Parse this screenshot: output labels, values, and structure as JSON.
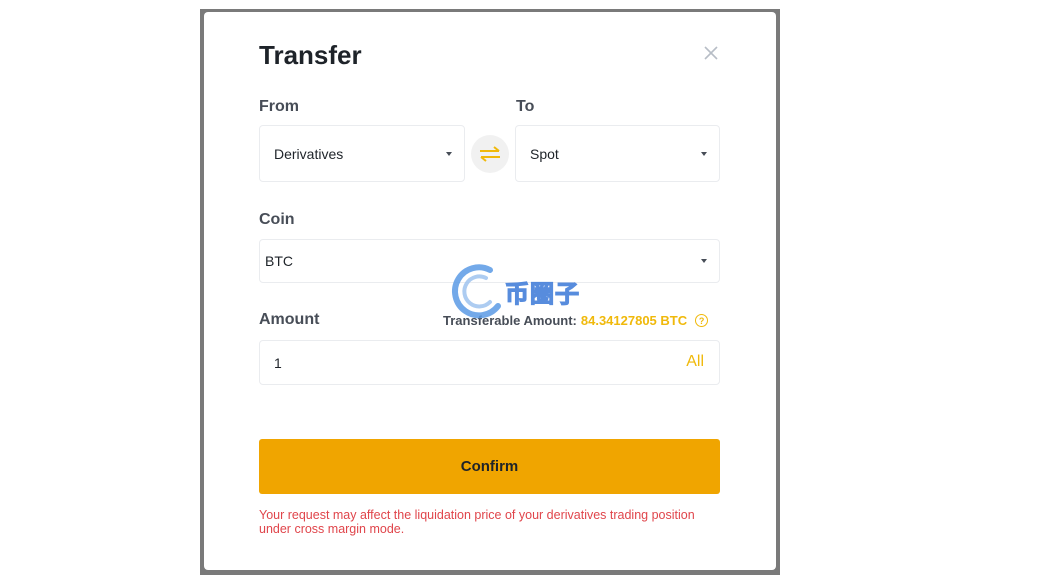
{
  "modal": {
    "title": "Transfer"
  },
  "from": {
    "label": "From",
    "value": "Derivatives"
  },
  "to": {
    "label": "To",
    "value": "Spot"
  },
  "coin": {
    "label": "Coin",
    "value": "BTC"
  },
  "amount": {
    "label": "Amount",
    "transferable_label": "Transferable Amount:",
    "transferable_value": "84.34127805 BTC",
    "input_value": "1",
    "all_label": "All"
  },
  "confirm": {
    "label": "Confirm"
  },
  "warning": "Your request may affect the liquidation price of your derivatives trading position under cross margin mode.",
  "watermark": {
    "text": "币圈子"
  },
  "colors": {
    "accent": "#f0b90b",
    "button": "#f0a500",
    "warning": "#e0454b"
  },
  "icons": {
    "close": "close-icon",
    "swap": "swap-arrows-icon",
    "help": "question-circle-icon",
    "caret": "caret-down-icon"
  }
}
